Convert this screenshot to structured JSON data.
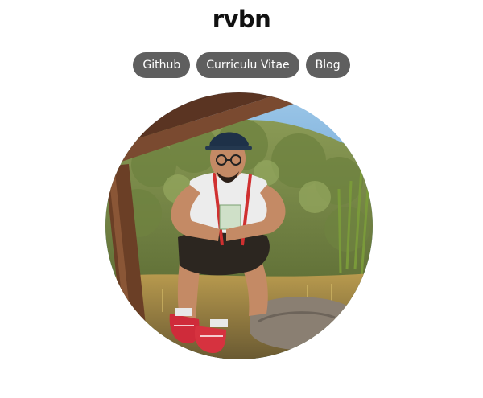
{
  "site": {
    "title": "rvbn"
  },
  "nav": {
    "links": [
      {
        "label": "Github"
      },
      {
        "label": "Curriculu Vitae"
      },
      {
        "label": "Blog"
      }
    ]
  },
  "avatar": {
    "icon": "profile-photo"
  },
  "colors": {
    "pill_background": "#5f5f5f",
    "pill_text": "#ffffff",
    "title_text": "#111111"
  }
}
